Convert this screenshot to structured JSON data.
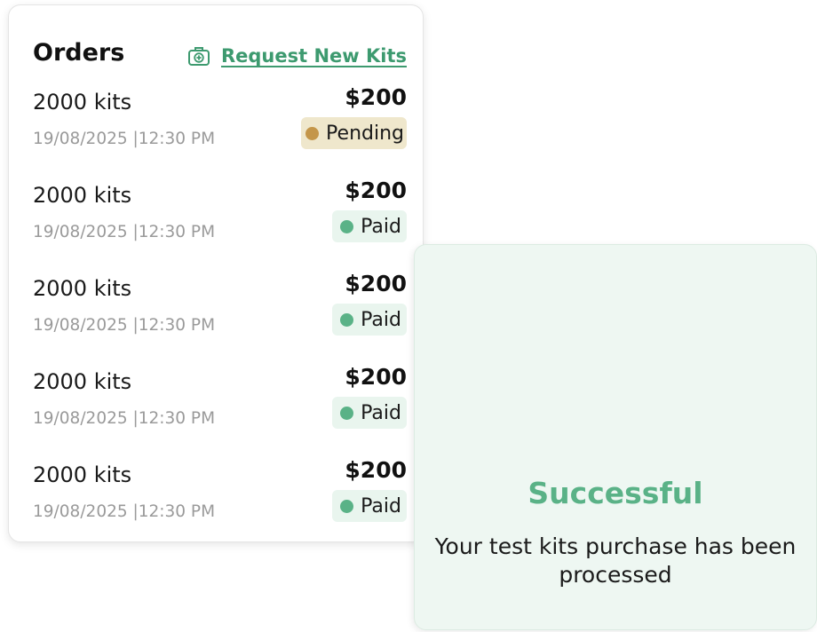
{
  "orders": {
    "title": "Orders",
    "request_link_label": "Request New Kits",
    "request_icon": "medical-kit-icon",
    "items": [
      {
        "name": "2000 kits",
        "datetime": "19/08/2025 |12:30 PM",
        "amount": "$200",
        "status": "Pending",
        "status_color": "#c4964a"
      },
      {
        "name": "2000 kits",
        "datetime": "19/08/2025 |12:30 PM",
        "amount": "$200",
        "status": "Paid",
        "status_color": "#5ab287"
      },
      {
        "name": "2000 kits",
        "datetime": "19/08/2025 |12:30 PM",
        "amount": "$200",
        "status": "Paid",
        "status_color": "#5ab287"
      },
      {
        "name": "2000 kits",
        "datetime": "19/08/2025 |12:30 PM",
        "amount": "$200",
        "status": "Paid",
        "status_color": "#5ab287"
      },
      {
        "name": "2000 kits",
        "datetime": "19/08/2025 |12:30 PM",
        "amount": "$200",
        "status": "Paid",
        "status_color": "#5ab287"
      }
    ]
  },
  "success": {
    "title": "Successful",
    "message": "Your test kits purchase has been processed"
  },
  "colors": {
    "accent": "#3d9a6f",
    "success_title": "#5ab287",
    "pending_bg": "#efe7cc",
    "paid_bg": "#e9f5ee"
  }
}
